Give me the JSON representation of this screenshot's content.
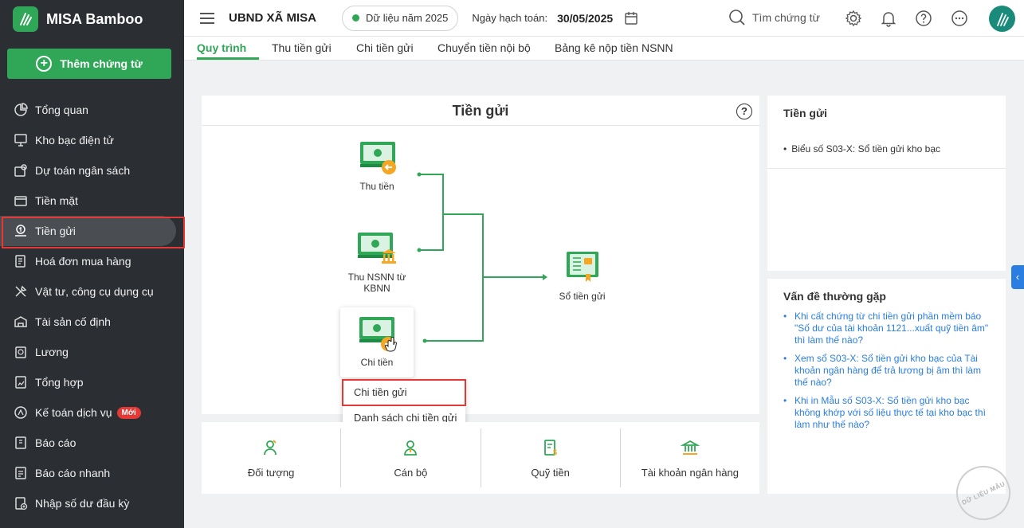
{
  "app": {
    "name": "MISA Bamboo"
  },
  "sidebar": {
    "add_button": "Thêm chứng từ",
    "items": [
      {
        "label": "Tổng quan",
        "icon": "pie-chart-icon"
      },
      {
        "label": "Kho bạc điện tử",
        "icon": "monitor-icon"
      },
      {
        "label": "Dự toán ngân sách",
        "icon": "budget-icon"
      },
      {
        "label": "Tiền mặt",
        "icon": "wallet-icon"
      },
      {
        "label": "Tiền gửi",
        "icon": "bank-deposit-icon",
        "active": true
      },
      {
        "label": "Hoá đơn mua hàng",
        "icon": "invoice-icon"
      },
      {
        "label": "Vật tư, công cụ dụng cụ",
        "icon": "tools-icon"
      },
      {
        "label": "Tài sản cố định",
        "icon": "building-icon"
      },
      {
        "label": "Lương",
        "icon": "salary-icon"
      },
      {
        "label": "Tổng hợp",
        "icon": "summary-icon"
      },
      {
        "label": "Kế toán dịch vụ",
        "icon": "service-icon",
        "badge": "Mới"
      },
      {
        "label": "Báo cáo",
        "icon": "report-icon"
      },
      {
        "label": "Báo cáo nhanh",
        "icon": "quick-report-icon"
      },
      {
        "label": "Nhập số dư đầu kỳ",
        "icon": "opening-balance-icon"
      }
    ]
  },
  "header": {
    "org": "UBND XÃ MISA",
    "year": "Dữ liệu năm 2025",
    "date_label": "Ngày hạch toán:",
    "date_value": "30/05/2025",
    "search_label": "Tìm chứng từ"
  },
  "tabs": [
    "Quy trình",
    "Thu tiền gửi",
    "Chi tiền gửi",
    "Chuyển tiền nội bộ",
    "Bảng kê nộp tiền NSNN"
  ],
  "flow": {
    "title": "Tiền gửi",
    "help": "?",
    "nodes": {
      "thu_tien": "Thu tiền",
      "thu_nsnn_line1": "Thu NSNN từ",
      "thu_nsnn_line2": "KBNN",
      "chi_tien": "Chi tiền",
      "so_tien_gui": "Sổ tiền gửi"
    },
    "menu": [
      "Chi tiền gửi",
      "Danh sách chi tiền gửi"
    ]
  },
  "bottom": [
    "Đối tượng",
    "Cán bộ",
    "Quỹ tiền",
    "Tài khoản ngân hàng"
  ],
  "side": {
    "reports_title": "Tiền gửi",
    "reports": [
      "Biểu số S03-X: Sổ tiền gửi kho bạc"
    ],
    "faq_title": "Vấn đề thường gặp",
    "faq": [
      "Khi cất chứng từ chi tiền gửi phần mềm báo \"Số dư của tài khoản 1121...xuất quỹ tiền âm\" thì làm thế nào?",
      "Xem sổ S03-X: Sổ tiền gửi kho bạc của Tài khoản ngân hàng để trả lương bị âm thì làm thế nào?",
      "Khi in Mẫu số S03-X: Sổ tiền gửi kho bạc không khớp với số liệu thực tế tại kho bạc thì làm như thế nào?"
    ]
  },
  "watermark": "DỮ LIỆU MẪU",
  "colors": {
    "brand_green": "#2fa757",
    "sidebar_bg": "#2b2e33",
    "link_blue": "#2a7de1",
    "highlight_red": "#e53935"
  }
}
